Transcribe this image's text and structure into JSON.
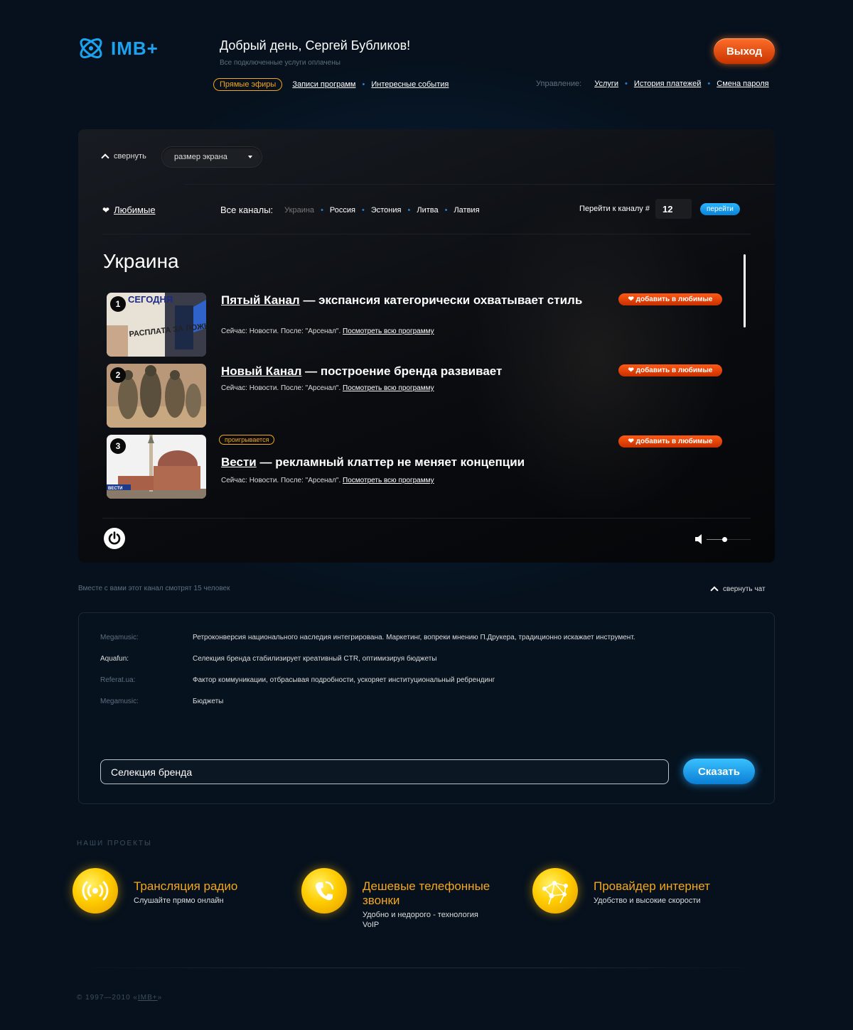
{
  "header": {
    "logo": "IMB+",
    "greeting": "Добрый день, Сергей Бубликов!",
    "status": "Все подключенные услуги оплачены",
    "logout_label": "Выход",
    "nav": [
      "Прямые эфиры",
      "Записи программ",
      "Интересные события"
    ],
    "manage_label": "Управление:",
    "manage": [
      "Услуги",
      "История платежей",
      "Смена пароля"
    ]
  },
  "player": {
    "collapse_label": "свернуть",
    "screen_size_label": "размер экрана",
    "favorites_label": "Любимые",
    "all_channels_label": "Все каналы:",
    "countries": [
      "Украина",
      "Россия",
      "Эстония",
      "Литва",
      "Латвия"
    ],
    "goto_label": "Перейти к каналу #",
    "goto_value": "12",
    "goto_button": "перейти",
    "region_title": "Украина",
    "channels": [
      {
        "num": "1",
        "name": "Пятый Канал",
        "title": " — экспансия категорически охватывает стиль",
        "now": "Сейчас: Новости. После: \"Арсенал\". ",
        "program_link": "Посмотреть всю программу",
        "fav": "добавить в любимые"
      },
      {
        "num": "2",
        "name": "Новый Канал",
        "title": " — построение бренда развивает",
        "now": "Сейчас: Новости. После: \"Арсенал\". ",
        "program_link": "Посмотреть всю программу",
        "fav": "добавить в любимые"
      },
      {
        "num": "3",
        "name": "Вести",
        "title": " — рекламный клаттер не меняет концепции",
        "now": "Сейчас: Новости. После: \"Арсенал\". ",
        "program_link": "Посмотреть всю программу",
        "fav": "добавить в любимые",
        "playing": "проигрывается"
      }
    ],
    "thumb_texts": {
      "paper": "СЕГОДНЯ",
      "headline": "РАСПЛАТА ЗА ЛОЖЬ",
      "vesti": "ВЕСТИ"
    },
    "volume": 0.4
  },
  "chat": {
    "viewers": "Вместе с вами этот канал смотрят 15 человек",
    "collapse_label": "свернуть чат",
    "messages": [
      {
        "user": "Megamusic:",
        "text": "Ретроконверсия национального наследия интегрирована. Маркетинг, вопреки мнению П.Друкера, традиционно искажает инструмент."
      },
      {
        "user": "Aquafun:",
        "text": "Селекция бренда стабилизирует креативный CTR, оптимизируя бюджеты"
      },
      {
        "user": "Referat.ua:",
        "text": "Фактор коммуникации, отбрасывая подробности, ускоряет институциональный ребрендинг"
      },
      {
        "user": "Megamusic:",
        "text": "Бюджеты"
      }
    ],
    "input_value": "Селекция бренда",
    "say_button": "Сказать"
  },
  "projects": {
    "heading": "НАШИ ПРОЕКТЫ",
    "items": [
      {
        "title": "Трансляция радио",
        "desc": "Слушайте прямо онлайн",
        "icon": "radio-icon"
      },
      {
        "title": "Дешевые телефонные звонки",
        "desc": "Удобно и недорого - технология VoIP",
        "icon": "phone-icon"
      },
      {
        "title": "Провайдер интернет",
        "desc": "Удобство и высокие скорости",
        "icon": "network-icon"
      }
    ]
  },
  "footer": {
    "years": "© 1997—2010 «",
    "brand": "IMB+",
    "close": "»"
  },
  "colors": {
    "accent_orange": "#f4a71c",
    "accent_blue": "#1ba3f0",
    "fav_red": "#e64a0a",
    "background": "#06111d"
  }
}
